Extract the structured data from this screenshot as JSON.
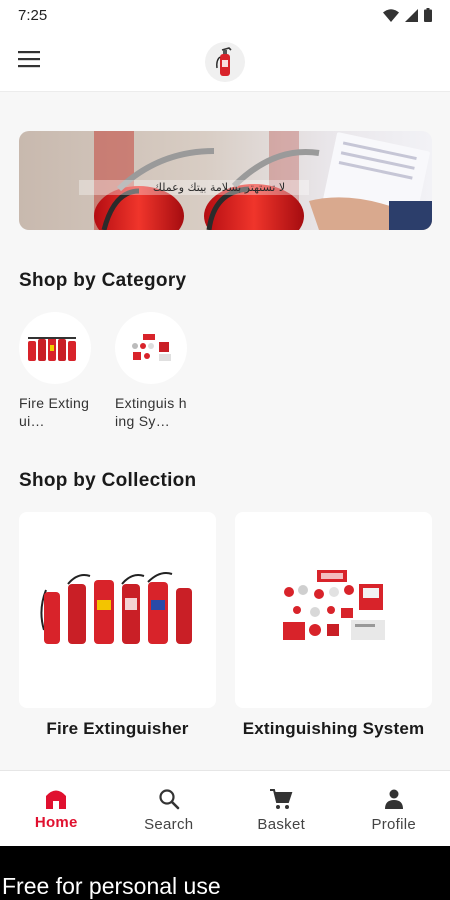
{
  "status_bar": {
    "time": "7:25"
  },
  "banner": {
    "text": "لا تستهتر بسلامة بيتك وعملك"
  },
  "sections": {
    "category_title": "Shop by Category",
    "collection_title": "Shop by Collection"
  },
  "categories": [
    {
      "label": "Fire Extingui…"
    },
    {
      "label": "Extinguis hing Sy…"
    }
  ],
  "collections": [
    {
      "label": "Fire Extinguisher"
    },
    {
      "label": "Extinguishing System"
    }
  ],
  "bottom_nav": [
    {
      "label": "Home",
      "icon": "home-icon",
      "active": true
    },
    {
      "label": "Search",
      "icon": "search-icon",
      "active": false
    },
    {
      "label": "Basket",
      "icon": "cart-icon",
      "active": false
    },
    {
      "label": "Profile",
      "icon": "person-icon",
      "active": false
    }
  ],
  "watermark": "Free for personal use",
  "colors": {
    "accent": "#e0102f",
    "background": "#f7f7f7",
    "card": "#ffffff"
  }
}
